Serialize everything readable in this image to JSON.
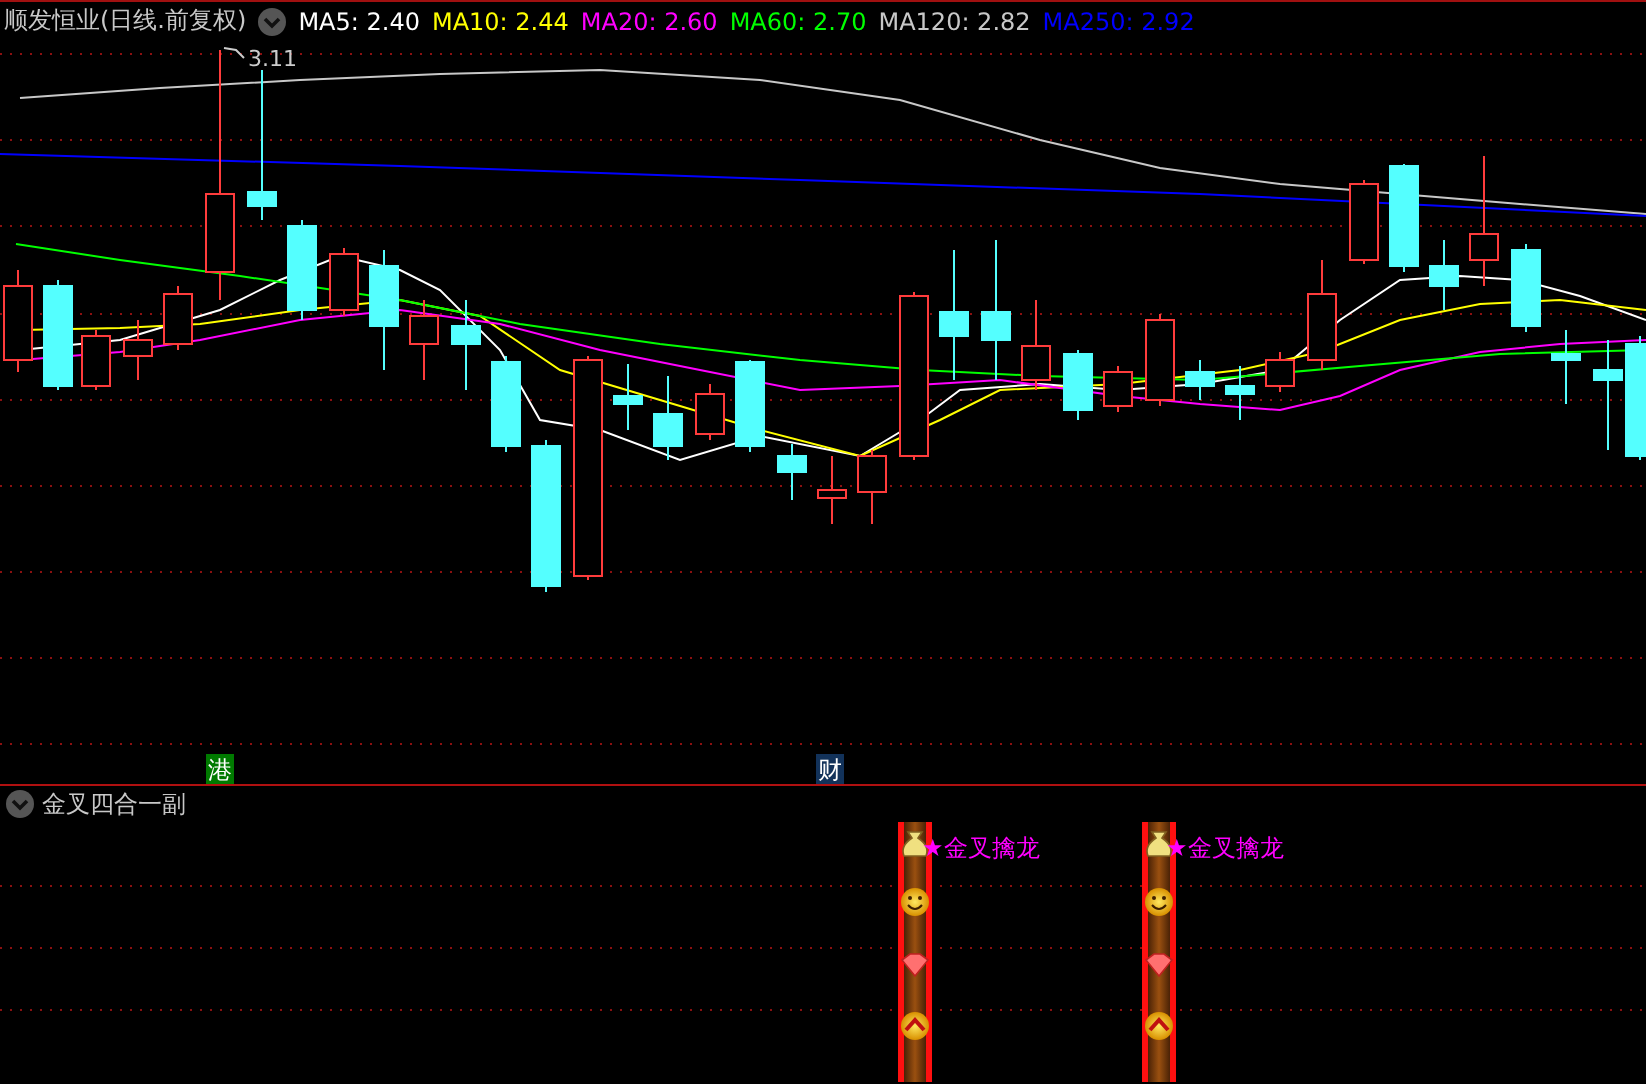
{
  "chart": {
    "title": "顺发恒业(日线.前复权)",
    "indicators": [
      {
        "label": "MA5: 2.40",
        "color": "#ffffff"
      },
      {
        "label": "MA10: 2.44",
        "color": "#ffff00"
      },
      {
        "label": "MA20: 2.60",
        "color": "#ff00ff"
      },
      {
        "label": "MA60: 2.70",
        "color": "#00ff00"
      },
      {
        "label": "MA120: 2.82",
        "color": "#c8c8c8"
      },
      {
        "label": "MA250: 2.92",
        "color": "#0000ff"
      }
    ],
    "peak_label": "3.11",
    "event_markers": [
      {
        "label": "港",
        "color": "#007a00"
      },
      {
        "label": "财",
        "color": "#12325a"
      }
    ]
  },
  "sub_panel": {
    "title": "金叉四合一副",
    "signals": [
      {
        "label": "★金叉擒龙"
      },
      {
        "label": "★金叉擒龙"
      }
    ]
  }
}
